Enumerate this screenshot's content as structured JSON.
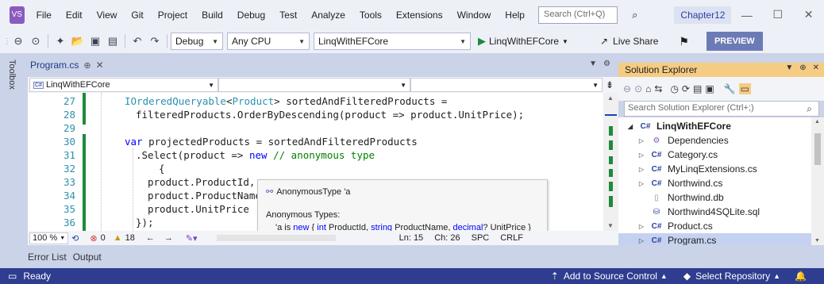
{
  "menubar": {
    "logo": "VS",
    "items": [
      "File",
      "Edit",
      "View",
      "Git",
      "Project",
      "Build",
      "Debug",
      "Test",
      "Analyze",
      "Tools",
      "Extensions",
      "Window",
      "Help"
    ],
    "search_placeholder": "Search (Ctrl+Q)",
    "solution_name": "Chapter12"
  },
  "toolbar": {
    "configuration": "Debug",
    "platform": "Any CPU",
    "startup_project": "LinqWithEFCore",
    "run_label": "LinqWithEFCore",
    "live_share": "Live Share",
    "preview": "PREVIEW"
  },
  "toolbox": {
    "label": "Toolbox"
  },
  "editor": {
    "tab_label": "Program.cs",
    "nav_project": "LinqWithEFCore",
    "lines": [
      {
        "num": "27"
      },
      {
        "num": "28"
      },
      {
        "num": "29"
      },
      {
        "num": "30"
      },
      {
        "num": "31"
      },
      {
        "num": "32"
      },
      {
        "num": "33"
      },
      {
        "num": "34"
      },
      {
        "num": "35"
      },
      {
        "num": "36"
      },
      {
        "num": "37"
      }
    ],
    "code": {
      "l27_type": "IOrderedQueryable",
      "l27_lt": "<",
      "l27_prod": "Product",
      "l27_rest": "> sortedAndFilteredProducts =",
      "l28": "filteredProducts.OrderByDescending(product => product.UnitPrice);",
      "l30_kw": "var",
      "l30_rest": " projectedProducts = sortedAndFilteredProducts",
      "l31_a": ".Select(product => ",
      "l31_kw": "new",
      "l31_cm": " // anonymous type",
      "l32": "{",
      "l33": "product.ProductId,",
      "l34": "product.ProductName",
      "l35": "product.UnitPrice",
      "l36": "});"
    },
    "tooltip": {
      "title": "AnonymousType 'a",
      "label": "Anonymous Types:",
      "def_a": "'a is ",
      "def_new": "new",
      "def_b": " { ",
      "def_int": "int",
      "def_c": " ProductId, ",
      "def_string": "string",
      "def_d": " ProductName, ",
      "def_decimal": "decimal",
      "def_e": "? UnitPrice }"
    },
    "status": {
      "zoom": "100 %",
      "errors": "0",
      "warnings": "18",
      "line": "Ln: 15",
      "col": "Ch: 26",
      "spc": "SPC",
      "eol": "CRLF"
    }
  },
  "bottom_tabs": [
    "Error List",
    "Output"
  ],
  "statusbar": {
    "ready": "Ready",
    "add_source_control": "Add to Source Control",
    "select_repository": "Select Repository"
  },
  "solution_explorer": {
    "title": "Solution Explorer",
    "search_placeholder": "Search Solution Explorer (Ctrl+;)",
    "items": [
      {
        "label": "LinqWithEFCore",
        "icon": "project-icon"
      },
      {
        "label": "Dependencies",
        "icon": "dependencies-icon"
      },
      {
        "label": "Category.cs",
        "icon": "csharp-file-icon"
      },
      {
        "label": "MyLinqExtensions.cs",
        "icon": "csharp-file-icon"
      },
      {
        "label": "Northwind.cs",
        "icon": "csharp-file-icon"
      },
      {
        "label": "Northwind.db",
        "icon": "file-icon"
      },
      {
        "label": "Northwind4SQLite.sql",
        "icon": "sql-file-icon"
      },
      {
        "label": "Product.cs",
        "icon": "csharp-file-icon"
      },
      {
        "label": "Program.cs",
        "icon": "csharp-file-icon"
      }
    ]
  },
  "colors": {
    "statusbar": "#2e3d8f",
    "accent": "#f5cc84",
    "change_bar": "#1f8a3b"
  }
}
